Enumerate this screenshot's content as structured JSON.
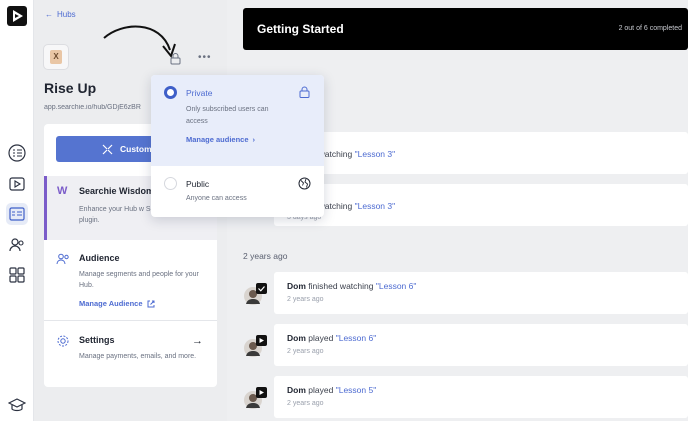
{
  "nav": {
    "back_label": "Hubs",
    "rail_icons": [
      "app-logo-icon",
      "checklist-icon",
      "video-library-icon",
      "hub-page-icon",
      "users-icon",
      "grid-icon",
      "graduation-cap-icon"
    ]
  },
  "hub": {
    "title": "Rise Up",
    "url": "app.searchie.io/hub/GDjE6zBR",
    "thumb_letter": "X",
    "more_label": "•••",
    "customize_label": "Customi",
    "wisdom": {
      "title": "Searchie Wisdom",
      "description": "Enhance your Hub w Searchie Wisdom plugin."
    },
    "audience": {
      "title": "Audience",
      "description": "Manage segments and people for your Hub.",
      "link": "Manage Audience"
    },
    "settings": {
      "title": "Settings",
      "description": "Manage payments, emails, and more."
    }
  },
  "getting_started": {
    "title": "Getting Started",
    "progress": "2 out of 6 completed"
  },
  "visibility_popover": {
    "options": [
      {
        "label": "Private",
        "description": "Only subscribed users can access",
        "link": "Manage audience",
        "selected": true
      },
      {
        "label": "Public",
        "description": "Anyone can access",
        "selected": false
      }
    ]
  },
  "activity": {
    "section_label": "2 years ago",
    "items": [
      {
        "user": "",
        "action": "finished watching",
        "lesson": "\"Lesson 3\"",
        "time": ""
      },
      {
        "user": "",
        "action": "finished watching",
        "lesson": "\"Lesson 3\"",
        "time": "3 days ago"
      },
      {
        "user": "Dom",
        "action": "finished watching",
        "lesson": "\"Lesson 6\"",
        "time": "2 years ago",
        "badge": "check"
      },
      {
        "user": "Dom",
        "action": "played",
        "lesson": "\"Lesson 6\"",
        "time": "2 years ago",
        "badge": "play"
      },
      {
        "user": "Dom",
        "action": "played",
        "lesson": "\"Lesson 5\"",
        "time": "2 years ago",
        "badge": "play"
      }
    ]
  },
  "colors": {
    "accent": "#4d6bd1",
    "button": "#5574d0",
    "wisdom": "#7b5cc9",
    "dark_bar": "#000000"
  }
}
